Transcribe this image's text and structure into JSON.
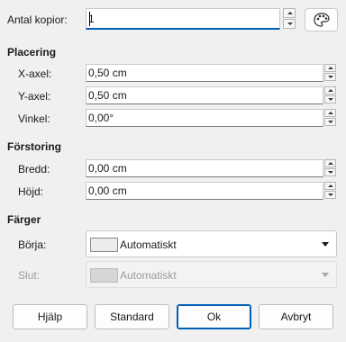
{
  "copies": {
    "label": "Antal kopior:",
    "value": "1"
  },
  "placement": {
    "heading": "Placering",
    "x_label": "X-axel:",
    "x_value": "0,50 cm",
    "y_label": "Y-axel:",
    "y_value": "0,50 cm",
    "angle_label": "Vinkel:",
    "angle_value": "0,00°"
  },
  "enlargement": {
    "heading": "Förstoring",
    "width_label": "Bredd:",
    "width_value": "0,00 cm",
    "height_label": "Höjd:",
    "height_value": "0,00 cm"
  },
  "colors": {
    "heading": "Färger",
    "start_label": "Börja:",
    "start_value": "Automatiskt",
    "end_label": "Slut:",
    "end_value": "Automatiskt"
  },
  "buttons": {
    "help": "Hjälp",
    "standard": "Standard",
    "ok": "Ok",
    "cancel": "Avbryt"
  },
  "icons": {
    "palette": "palette-icon",
    "spin_up": "spin-up-icon",
    "spin_down": "spin-down-icon",
    "dropdown": "chevron-down-icon"
  },
  "colors_ui": {
    "accent": "#005fb8",
    "background": "#f0f0f0"
  }
}
